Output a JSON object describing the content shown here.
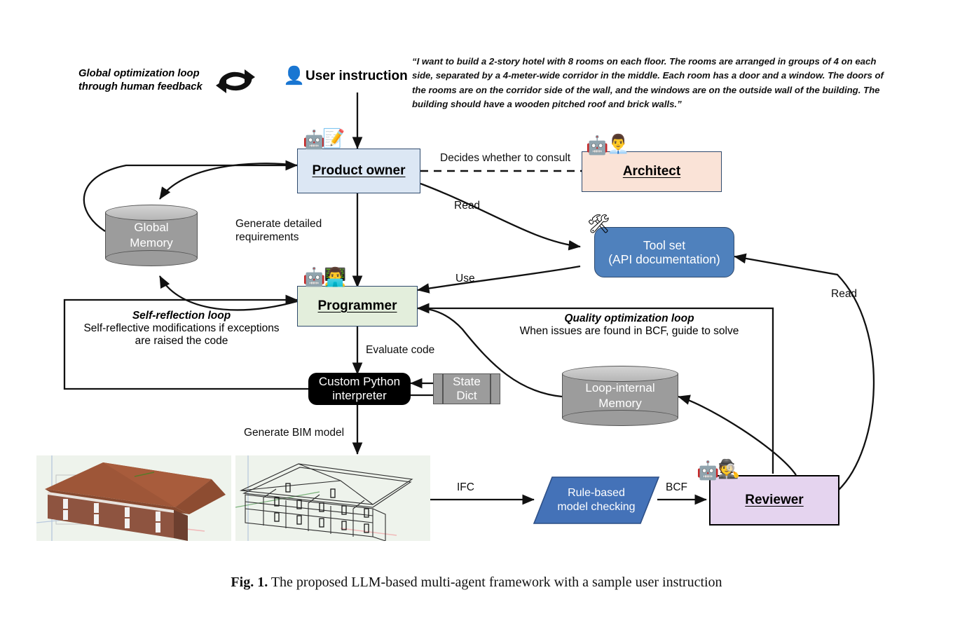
{
  "figure": {
    "caption_label": "Fig. 1.",
    "caption_text": " The proposed LLM-based multi-agent framework with a sample user instruction"
  },
  "annotations": {
    "global_loop_line1": "Global optimization loop",
    "global_loop_line2": "through human feedback",
    "global_loop_icon": "refresh-cycle-icon",
    "user_instruction_label": "User instruction",
    "user_icon": "user-silhouette-icon",
    "user_instruction_text": "“I want to build a 2-story hotel with 8 rooms on each floor. The rooms are arranged in groups of 4 on each side, separated by a 4-meter-wide corridor in the middle. Each room has a door and a window. The doors of the rooms are on the corridor side of the wall, and the windows are on the outside wall of the building. The building should have a wooden pitched roof and brick walls.”"
  },
  "nodes": {
    "product_owner": {
      "label": "Product owner",
      "fill": "#dce7f4",
      "icons": [
        "robot-icon",
        "memo-pencil-icon"
      ]
    },
    "architect": {
      "label": "Architect",
      "fill": "#fae3d7",
      "icons": [
        "robot-icon",
        "office-worker-icon"
      ]
    },
    "programmer": {
      "label": "Programmer",
      "fill": "#e3eedc",
      "icons": [
        "robot-icon",
        "technologist-icon"
      ]
    },
    "reviewer": {
      "label": "Reviewer",
      "fill": "#e5d4ef",
      "icons": [
        "robot-icon",
        "detective-icon"
      ]
    },
    "global_memory": {
      "line1": "Global",
      "line2": "Memory",
      "fill": "#9c9c9c"
    },
    "loop_memory": {
      "line1": "Loop-internal",
      "line2": "Memory",
      "fill": "#9c9c9c"
    },
    "tool_set": {
      "line1": "Tool set",
      "line2": "(API documentation)",
      "fill": "#4f81bd",
      "icon": "tools-hammer-wrench-icon"
    },
    "interpreter": {
      "line1": "Custom Python",
      "line2": "interpreter",
      "fill": "#000000"
    },
    "state_dict": {
      "line1": "State",
      "line2": "Dict",
      "fill": "#9c9c9c"
    },
    "model_checking": {
      "line1": "Rule-based",
      "line2": "model checking",
      "fill": "#4472b8"
    }
  },
  "edge_labels": {
    "decides": "Decides whether to consult",
    "read_top": "Read",
    "generate_requirements_l1": "Generate detailed",
    "generate_requirements_l2": "requirements",
    "use": "Use",
    "read_right": "Read",
    "evaluate_code": "Evaluate code",
    "generate_bim": "Generate BIM model",
    "ifc": "IFC",
    "bcf": "BCF"
  },
  "loops": {
    "self_reflection_title": "Self-reflection loop",
    "self_reflection_line1": "Self-reflective modifications if exceptions",
    "self_reflection_line2": "are raised the code",
    "quality_title": "Quality optimization loop",
    "quality_line1": "When issues are found in BCF, guide to solve"
  },
  "renders": {
    "solid_model_alt": "3d-brick-hotel-pitched-roof-render",
    "wireframe_model_alt": "3d-wireframe-hotel-rooms-render"
  },
  "colors": {
    "product_owner": "#dce7f4",
    "architect": "#fae3d7",
    "programmer": "#e3eedc",
    "reviewer": "#e5d4ef",
    "tool_set": "#4f81bd",
    "model_checking": "#4472b8",
    "memory_gray": "#9c9c9c",
    "interpreter_black": "#000000",
    "stroke": "#111111"
  }
}
